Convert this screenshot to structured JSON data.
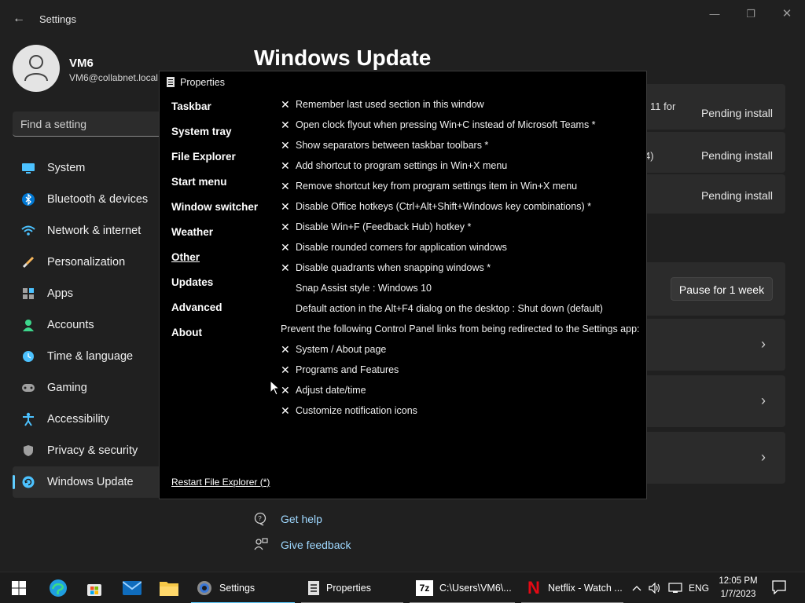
{
  "settings": {
    "app_title": "Settings",
    "back_glyph": "←",
    "window_controls": {
      "minimize": "—",
      "maximize": "❐",
      "close": "✕"
    },
    "user": {
      "name": "VM6",
      "email": "VM6@collabnet.local"
    },
    "search": {
      "placeholder": "Find a setting"
    },
    "nav": [
      {
        "label": "System",
        "icon": "system-icon"
      },
      {
        "label": "Bluetooth & devices",
        "icon": "bluetooth-icon"
      },
      {
        "label": "Network & internet",
        "icon": "network-icon"
      },
      {
        "label": "Personalization",
        "icon": "brush-icon"
      },
      {
        "label": "Apps",
        "icon": "apps-icon"
      },
      {
        "label": "Accounts",
        "icon": "accounts-icon"
      },
      {
        "label": "Time & language",
        "icon": "clock-icon"
      },
      {
        "label": "Gaming",
        "icon": "gamepad-icon"
      },
      {
        "label": "Accessibility",
        "icon": "accessibility-icon"
      },
      {
        "label": "Privacy & security",
        "icon": "shield-icon"
      },
      {
        "label": "Windows Update",
        "icon": "windows-update-icon"
      }
    ],
    "active_nav": "Windows Update",
    "page_title": "Windows Update",
    "updates": [
      {
        "text_fragment": "11 for",
        "status": "Pending install"
      },
      {
        "text_fragment": "4)",
        "status": "Pending install"
      },
      {
        "text_fragment": "",
        "status": "Pending install"
      }
    ],
    "pause_label": "Pause for 1 week",
    "chevron_glyph": "›",
    "get_help": "Get help",
    "give_feedback": "Give feedback"
  },
  "properties": {
    "title": "Properties",
    "sections": [
      "Taskbar",
      "System tray",
      "File Explorer",
      "Start menu",
      "Window switcher",
      "Weather",
      "Other",
      "Updates",
      "Advanced",
      "About"
    ],
    "active_section": "Other",
    "x_glyph": "✕",
    "options": [
      {
        "checked": true,
        "label": "Remember last used section in this window"
      },
      {
        "checked": true,
        "label": "Open clock flyout when pressing Win+C instead of Microsoft Teams *"
      },
      {
        "checked": true,
        "label": "Show separators between taskbar toolbars *"
      },
      {
        "checked": true,
        "label": "Add shortcut to program settings in Win+X menu"
      },
      {
        "checked": true,
        "label": "Remove shortcut key from program settings item in Win+X menu"
      },
      {
        "checked": true,
        "label": "Disable Office hotkeys (Ctrl+Alt+Shift+Windows key combinations) *"
      },
      {
        "checked": true,
        "label": "Disable Win+F (Feedback Hub) hotkey *"
      },
      {
        "checked": true,
        "label": "Disable rounded corners for application windows"
      },
      {
        "checked": true,
        "label": "Disable quadrants when snapping windows *"
      },
      {
        "checked": false,
        "label": "Snap Assist style : Windows 10"
      },
      {
        "checked": false,
        "label": "Default action in the Alt+F4 dialog on the desktop : Shut down (default)"
      }
    ],
    "redirect_heading": "Prevent the following Control Panel links from being redirected to the Settings app:",
    "redirect_options": [
      {
        "checked": true,
        "label": "System / About page"
      },
      {
        "checked": true,
        "label": "Programs and Features"
      },
      {
        "checked": true,
        "label": "Adjust date/time"
      },
      {
        "checked": true,
        "label": "Customize notification icons"
      }
    ],
    "restart_link": "Restart File Explorer (*)"
  },
  "taskbar": {
    "pinned": [
      "start-icon",
      "edge-icon",
      "store-icon",
      "mail-icon",
      "file-explorer-icon"
    ],
    "apps": [
      {
        "label": "Settings",
        "icon": "settings-gear-icon"
      },
      {
        "label": "Properties",
        "icon": "properties-icon"
      },
      {
        "label": "C:\\Users\\VM6\\...",
        "icon": "7zip-icon",
        "icon_text": "7z"
      },
      {
        "label": "Netflix - Watch ...",
        "icon": "netflix-icon",
        "icon_text": "N"
      }
    ],
    "tray": {
      "chevron": "^",
      "language": "ENG"
    },
    "clock": {
      "time": "12:05 PM",
      "date": "1/7/2023"
    }
  },
  "colors": {
    "accent": "#60cdff",
    "dialog_bg": "#000000",
    "settings_bg": "#202020",
    "taskbar_bg": "#1c1c1c",
    "netflix_red": "#e50914"
  }
}
